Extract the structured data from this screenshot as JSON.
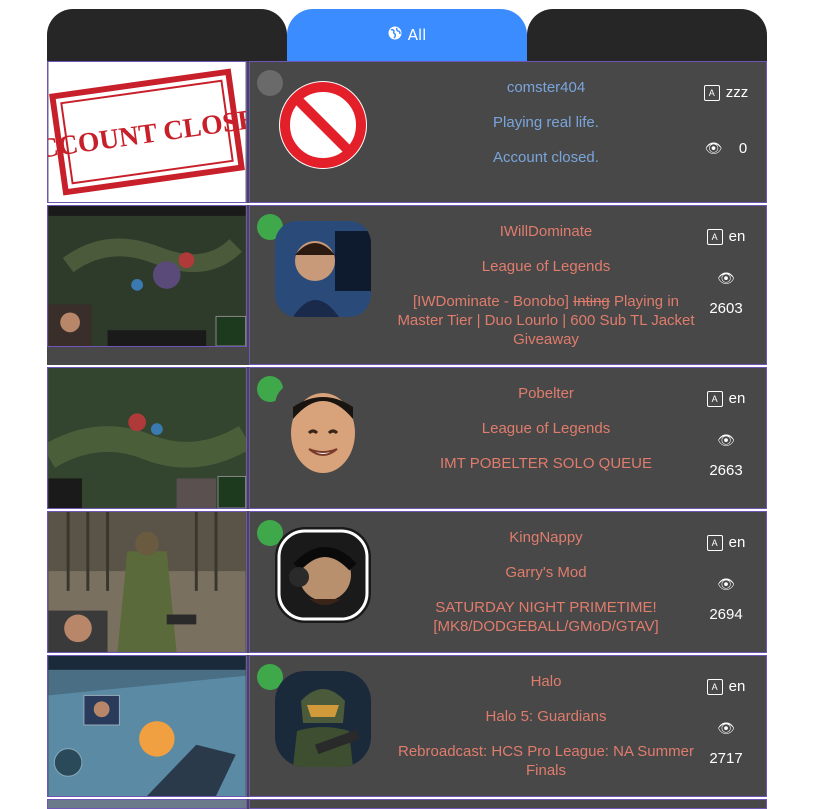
{
  "tabs": [
    {
      "label": ""
    },
    {
      "label": "All",
      "icon": "globe-icon",
      "active": true
    },
    {
      "label": ""
    }
  ],
  "colors": {
    "active_tab": "#3b8cff",
    "row_bg": "#484848",
    "border": "#6f55b8",
    "offline_text": "#7aa5dc",
    "online_text": "#e07c6c",
    "online_dot": "#3fa84a",
    "offline_dot": "#6a6a6a"
  },
  "streams": [
    {
      "name": "comster404",
      "game": "Playing real life.",
      "title": "Account closed.",
      "title_strike": "",
      "title_rest": "",
      "language": "zzz",
      "viewers": "0",
      "status": "offline"
    },
    {
      "name": "IWillDominate",
      "game": "League of Legends",
      "title": "[IWDominate - Bonobo] ",
      "title_strike": "Inting",
      "title_rest": " Playing in Master Tier | Duo Lourlo | 600 Sub TL Jacket Giveaway",
      "language": "en",
      "viewers": "2603",
      "status": "online"
    },
    {
      "name": "Pobelter",
      "game": "League of Legends",
      "title": "IMT POBELTER SOLO QUEUE",
      "title_strike": "",
      "title_rest": "",
      "language": "en",
      "viewers": "2663",
      "status": "online"
    },
    {
      "name": "KingNappy",
      "game": "Garry's Mod",
      "title": "SATURDAY NIGHT PRIMETIME! [MK8/DODGEBALL/GMoD/GTAV]",
      "title_strike": "",
      "title_rest": "",
      "language": "en",
      "viewers": "2694",
      "status": "online"
    },
    {
      "name": "Halo",
      "game": "Halo 5: Guardians",
      "title": "Rebroadcast: HCS Pro League: NA Summer Finals",
      "title_strike": "",
      "title_rest": "",
      "language": "en",
      "viewers": "2717",
      "status": "online"
    }
  ],
  "account_closed_stamp": "ACCOUNT CLOSED"
}
